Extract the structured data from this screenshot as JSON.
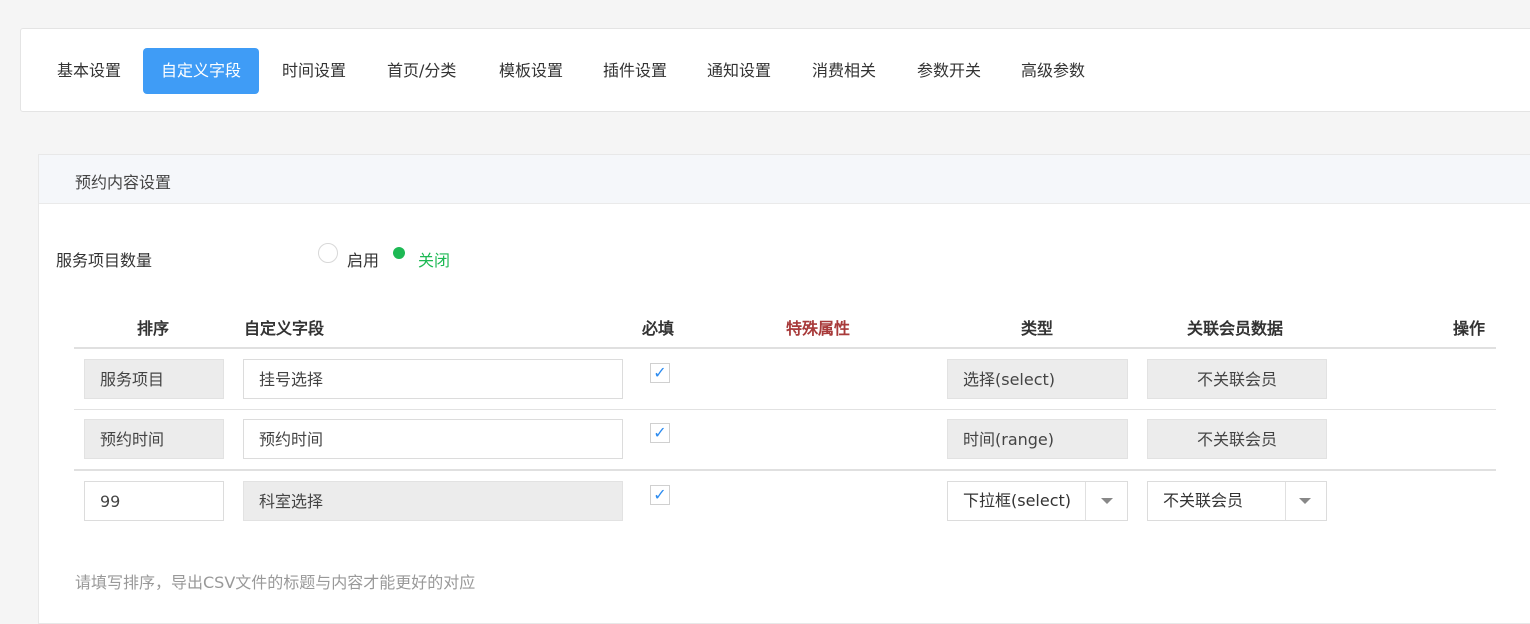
{
  "tabs": [
    {
      "label": "基本设置",
      "active": false
    },
    {
      "label": "自定义字段",
      "active": true
    },
    {
      "label": "时间设置",
      "active": false
    },
    {
      "label": "首页/分类",
      "active": false
    },
    {
      "label": "模板设置",
      "active": false
    },
    {
      "label": "插件设置",
      "active": false
    },
    {
      "label": "通知设置",
      "active": false
    },
    {
      "label": "消费相关",
      "active": false
    },
    {
      "label": "参数开关",
      "active": false
    },
    {
      "label": "高级参数",
      "active": false
    }
  ],
  "panel": {
    "title": "预约内容设置",
    "service_count": {
      "label": "服务项目数量",
      "option_on": "启用",
      "option_off": "关闭",
      "selected": "关闭"
    },
    "table": {
      "headers": {
        "sort": "排序",
        "field": "自定义字段",
        "required": "必填",
        "special": "特殊属性",
        "type": "类型",
        "member": "关联会员数据",
        "action": "操作"
      },
      "rows": [
        {
          "sort": "服务项目",
          "field": "挂号选择",
          "required": true,
          "type": "选择(select)",
          "member": "不关联会员"
        },
        {
          "sort": "预约时间",
          "field": "预约时间",
          "required": true,
          "type": "时间(range)",
          "member": "不关联会员"
        },
        {
          "sort": "99",
          "field": "科室选择",
          "required": true,
          "type": "下拉框(select)",
          "member": "不关联会员"
        }
      ]
    },
    "hint": "请填写排序，导出CSV文件的标题与内容才能更好的对应"
  },
  "colors": {
    "accent": "#3f9cf6",
    "radio_on": "#1db954",
    "special_header": "#a83a3a"
  }
}
